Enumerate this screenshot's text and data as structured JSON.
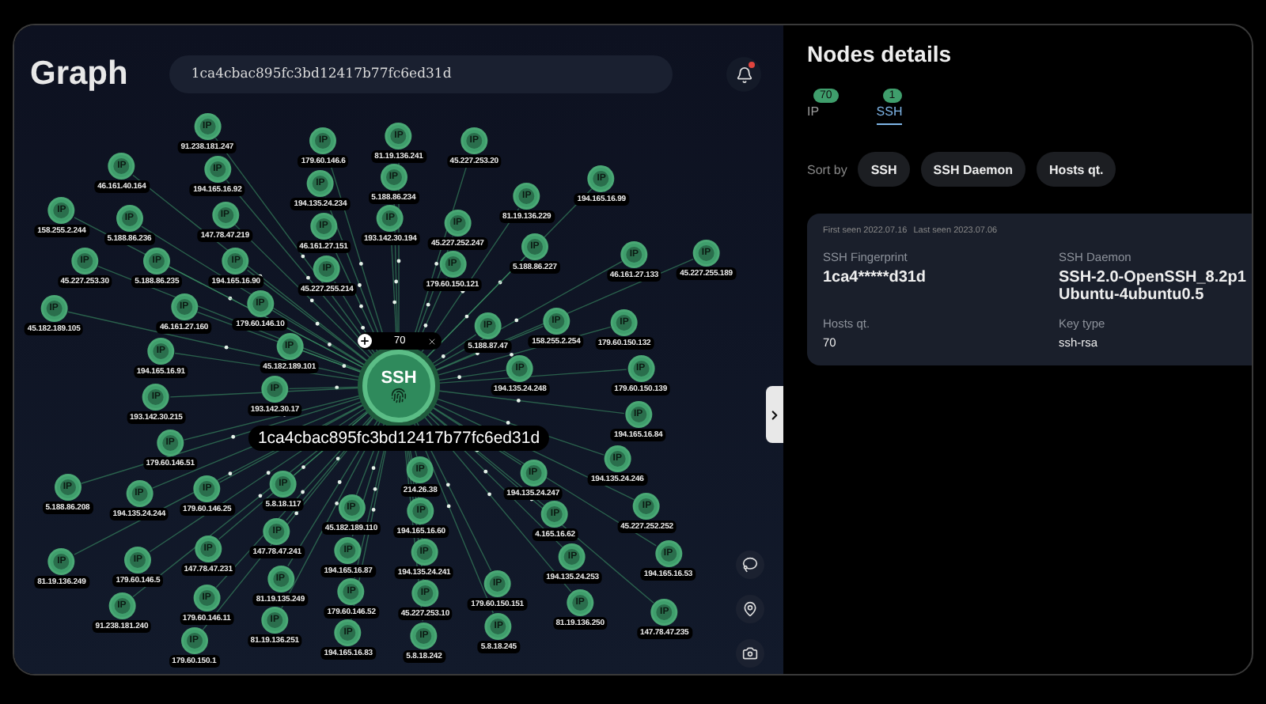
{
  "header": {
    "title": "Graph",
    "search_value": "1ca4cbac895fc3bd12417b77fc6ed31d",
    "notification_dot": true
  },
  "graph": {
    "center": {
      "type": "SSH",
      "label": "1ca4cbac895fc3bd12417b77fc6ed31d",
      "count": "70"
    },
    "nodes": [
      {
        "type": "IP",
        "label": "91.238.181.247"
      },
      {
        "type": "IP",
        "label": "179.60.146.6"
      },
      {
        "type": "IP",
        "label": "81.19.136.241"
      },
      {
        "type": "IP",
        "label": "45.227.253.20"
      },
      {
        "type": "IP",
        "label": "46.161.40.164"
      },
      {
        "type": "IP",
        "label": "194.165.16.92"
      },
      {
        "type": "IP",
        "label": "194.135.24.234"
      },
      {
        "type": "IP",
        "label": "5.188.86.234"
      },
      {
        "type": "IP",
        "label": "194.165.16.99"
      },
      {
        "type": "IP",
        "label": "158.255.2.244"
      },
      {
        "type": "IP",
        "label": "147.78.47.219"
      },
      {
        "type": "IP",
        "label": "81.19.136.229"
      },
      {
        "type": "IP",
        "label": "5.188.86.236"
      },
      {
        "type": "IP",
        "label": "46.161.27.151"
      },
      {
        "type": "IP",
        "label": "193.142.30.194"
      },
      {
        "type": "IP",
        "label": "45.227.252.247"
      },
      {
        "type": "IP",
        "label": "5.188.86.227"
      },
      {
        "type": "IP",
        "label": "46.161.27.133"
      },
      {
        "type": "IP",
        "label": "45.227.255.189"
      },
      {
        "type": "IP",
        "label": "45.227.253.30"
      },
      {
        "type": "IP",
        "label": "5.188.86.235"
      },
      {
        "type": "IP",
        "label": "194.165.16.90"
      },
      {
        "type": "IP",
        "label": "45.227.255.214"
      },
      {
        "type": "IP",
        "label": "179.60.150.121"
      },
      {
        "type": "IP",
        "label": "179.60.146.10"
      },
      {
        "type": "IP",
        "label": "45.182.189.105"
      },
      {
        "type": "IP",
        "label": "46.161.27.160"
      },
      {
        "type": "IP",
        "label": "158.255.2.254"
      },
      {
        "type": "IP",
        "label": "179.60.150.132"
      },
      {
        "type": "IP",
        "label": "45.182.189.101"
      },
      {
        "type": "IP",
        "label": "5.188.87.47"
      },
      {
        "type": "IP",
        "label": "194.165.16.91"
      },
      {
        "type": "IP",
        "label": "194.135.24.248"
      },
      {
        "type": "IP",
        "label": "179.60.150.139"
      },
      {
        "type": "IP",
        "label": "193.142.30.17"
      },
      {
        "type": "IP",
        "label": "193.142.30.215"
      },
      {
        "type": "IP",
        "label": "194.165.16.84"
      },
      {
        "type": "IP",
        "label": "179.60.146.51"
      },
      {
        "type": "IP",
        "label": "214.26.38"
      },
      {
        "type": "IP",
        "label": "194.135.24.247"
      },
      {
        "type": "IP",
        "label": "194.135.24.246"
      },
      {
        "type": "IP",
        "label": "5.188.86.208"
      },
      {
        "type": "IP",
        "label": "194.135.24.244"
      },
      {
        "type": "IP",
        "label": "179.60.146.25"
      },
      {
        "type": "IP",
        "label": "5.8.18.117"
      },
      {
        "type": "IP",
        "label": "45.182.189.110"
      },
      {
        "type": "IP",
        "label": "194.165.16.60"
      },
      {
        "type": "IP",
        "label": "4.165.16.62"
      },
      {
        "type": "IP",
        "label": "45.227.252.252"
      },
      {
        "type": "IP",
        "label": "147.78.47.241"
      },
      {
        "type": "IP",
        "label": "81.19.136.249"
      },
      {
        "type": "IP",
        "label": "179.60.146.5"
      },
      {
        "type": "IP",
        "label": "147.78.47.231"
      },
      {
        "type": "IP",
        "label": "194.165.16.87"
      },
      {
        "type": "IP",
        "label": "194.135.24.241"
      },
      {
        "type": "IP",
        "label": "194.135.24.253"
      },
      {
        "type": "IP",
        "label": "194.165.16.53"
      },
      {
        "type": "IP",
        "label": "81.19.135.249"
      },
      {
        "type": "IP",
        "label": "179.60.150.151"
      },
      {
        "type": "IP",
        "label": "91.238.181.240"
      },
      {
        "type": "IP",
        "label": "179.60.146.11"
      },
      {
        "type": "IP",
        "label": "179.60.146.52"
      },
      {
        "type": "IP",
        "label": "45.227.253.10"
      },
      {
        "type": "IP",
        "label": "81.19.136.250"
      },
      {
        "type": "IP",
        "label": "147.78.47.235"
      },
      {
        "type": "IP",
        "label": "81.19.136.251"
      },
      {
        "type": "IP",
        "label": "194.165.16.83"
      },
      {
        "type": "IP",
        "label": "5.8.18.242"
      },
      {
        "type": "IP",
        "label": "5.8.18.245"
      },
      {
        "type": "IP",
        "label": "179.60.150.1"
      }
    ]
  },
  "details": {
    "title": "Nodes details",
    "tabs": [
      {
        "label": "IP",
        "count": "70",
        "selected": false
      },
      {
        "label": "SSH",
        "count": "1",
        "selected": true
      }
    ],
    "sort_label": "Sort by",
    "sort_options": [
      "SSH",
      "SSH Daemon",
      "Hosts qt."
    ],
    "card": {
      "first_seen": "First seen 2022.07.16",
      "last_seen": "Last seen 2023.07.06",
      "fields": [
        {
          "label": "SSH Fingerprint",
          "value": "1ca4*****d31d",
          "kind": "large"
        },
        {
          "label": "SSH Daemon",
          "value": "SSH-2.0-OpenSSH_8.2p1 Ubuntu-4ubuntu0.5",
          "kind": "large"
        },
        {
          "label": "Hosts qt.",
          "value": "70",
          "kind": "small"
        },
        {
          "label": "Key type",
          "value": "ssh-rsa",
          "kind": "small"
        }
      ]
    }
  }
}
